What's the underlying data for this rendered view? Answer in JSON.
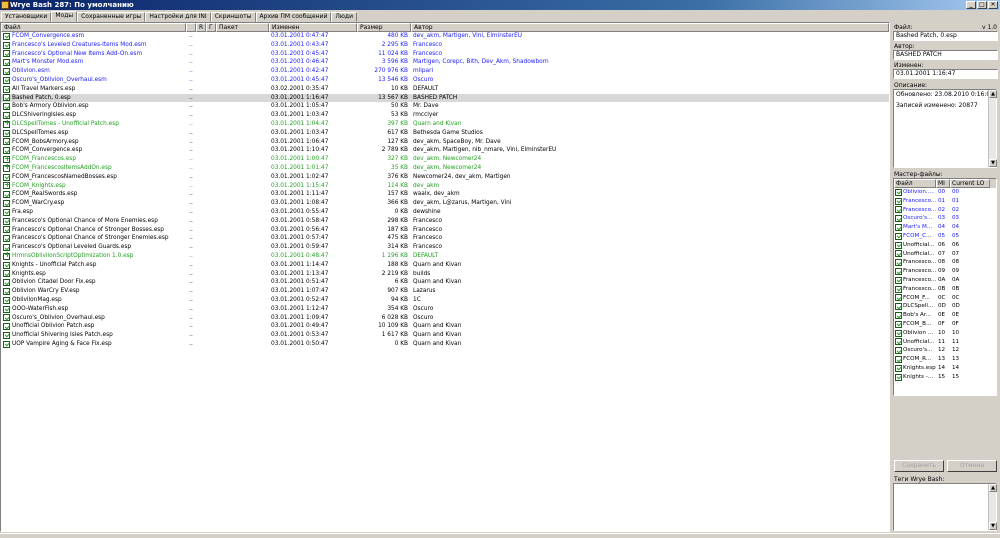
{
  "window": {
    "title": "Wrye Bash 287: По умолчанию",
    "minimize": "_",
    "maximize": "□",
    "close": "✕"
  },
  "tabs": [
    "Установщики",
    "Моды",
    "Сохраненные игры",
    "Настройки для INI",
    "Скриншоты",
    "Архив ПМ сообщений",
    "Люди"
  ],
  "active_tab": 1,
  "columns": {
    "file": "Файл",
    "flag1": "",
    "rating": "R",
    "group": "Г",
    "package": "Пакет",
    "modified": "Изменен",
    "size": "Размер",
    "author": "Автор"
  },
  "mods": [
    {
      "check": "on",
      "color": "blue",
      "file": "FCOM_Convergence.esm",
      "flag": "..",
      "modified": "03.01.2001 0:47:47",
      "size": "480 KB",
      "author": "dev_akm, Martigen, Vini, ElminsterEU"
    },
    {
      "check": "on",
      "color": "blue",
      "file": "Francesco's Leveled Creatures-Items Mod.esm",
      "flag": "..",
      "modified": "03.01.2001 0:43:47",
      "size": "2 295 KB",
      "author": "Francesco"
    },
    {
      "check": "on",
      "color": "blue",
      "file": "Francesco's Optional New Items Add-On.esm",
      "flag": "..",
      "modified": "03.01.2001 0:45:47",
      "size": "11 024 KB",
      "author": "Francesco"
    },
    {
      "check": "on",
      "color": "blue",
      "file": "Mart's Monster Mod.esm",
      "flag": "..",
      "modified": "03.01.2001 0:46:47",
      "size": "3 596 KB",
      "author": "Martigen, Corepc, Bith, Dev_Akm, Shadowborn"
    },
    {
      "check": "on",
      "color": "blue",
      "file": "Oblivion.esm",
      "flag": "..",
      "modified": "03.01.2001 0:42:47",
      "size": "270 976 KB",
      "author": "mlipari"
    },
    {
      "check": "on",
      "color": "blue",
      "file": "Oscuro's_Oblivion_Overhaul.esm",
      "flag": "..",
      "modified": "03.01.2001 0:45:47",
      "size": "13 546 KB",
      "author": "Oscuro"
    },
    {
      "check": "on",
      "color": "black",
      "file": "All Travel Markers.esp",
      "flag": "..",
      "modified": "03.02.2001 0:35:47",
      "size": "10 KB",
      "author": "DEFAULT"
    },
    {
      "check": "on",
      "color": "black",
      "file": "Bashed Patch, 0.esp",
      "flag": "..",
      "modified": "03.01.2001 1:16:47",
      "size": "13 567 KB",
      "author": "BASHED PATCH",
      "selected": true
    },
    {
      "check": "on",
      "color": "black",
      "file": "Bob's Armory Oblivion.esp",
      "flag": "..",
      "modified": "03.01.2001 1:05:47",
      "size": "50 KB",
      "author": "Mr. Dave"
    },
    {
      "check": "on",
      "color": "black",
      "file": "DLCShiveringIsles.esp",
      "flag": "..",
      "modified": "03.01.2001 1:03:47",
      "size": "53 KB",
      "author": "rmcclyer"
    },
    {
      "check": "plus",
      "color": "green",
      "file": "DLCSpellTomes - Unofficial Patch.esp",
      "flag": "..",
      "modified": "03.01.2001 1:04:47",
      "size": "397 KB",
      "author": "Quarn and Kivan"
    },
    {
      "check": "on",
      "color": "black",
      "file": "DLCSpellTomes.esp",
      "flag": "..",
      "modified": "03.01.2001 1:03:47",
      "size": "617 KB",
      "author": "Bethesda Game Studios"
    },
    {
      "check": "on",
      "color": "black",
      "file": "FCOM_BobsArmory.esp",
      "flag": "..",
      "modified": "03.01.2001 1:06:47",
      "size": "127 KB",
      "author": "dev_akm, SpaceBoy, Mr. Dave"
    },
    {
      "check": "on",
      "color": "black",
      "file": "FCOM_Convergence.esp",
      "flag": "..",
      "modified": "03.01.2001 1:10:47",
      "size": "2 789 KB",
      "author": "dev_akm, Martigen, nib_nmare, Vini, ElminsterEU"
    },
    {
      "check": "plus",
      "color": "green",
      "file": "FCOM_Francescos.esp",
      "flag": "..",
      "modified": "03.01.2001 1:00:47",
      "size": "327 KB",
      "author": "dev_akm, Newcomer24"
    },
    {
      "check": "plus",
      "color": "green",
      "file": "FCOM_FrancescosItemsAddOn.esp",
      "flag": "..",
      "modified": "03.01.2001 1:01:47",
      "size": "35 KB",
      "author": "dev_akm, Newcomer24"
    },
    {
      "check": "on",
      "color": "black",
      "file": "FCOM_FrancescosNamedBosses.esp",
      "flag": "..",
      "modified": "03.01.2001 1:02:47",
      "size": "376 KB",
      "author": "Newcomer24, dev_akm, Martigen"
    },
    {
      "check": "plus",
      "color": "green",
      "file": "FCOM_Knights.esp",
      "flag": "..",
      "modified": "03.01.2001 1:15:47",
      "size": "114 KB",
      "author": "dev_akm"
    },
    {
      "check": "on",
      "color": "black",
      "file": "FCOM_RealSwords.esp",
      "flag": "..",
      "modified": "03.01.2001 1:11:47",
      "size": "157 KB",
      "author": "waalx, dev_akm"
    },
    {
      "check": "on",
      "color": "black",
      "file": "FCOM_WarCry.esp",
      "flag": "..",
      "modified": "03.01.2001 1:08:47",
      "size": "366 KB",
      "author": "dev_akm, L@zarus, Martigen, Vini"
    },
    {
      "check": "on",
      "color": "black",
      "file": "Fra.esp",
      "flag": "..",
      "modified": "03.01.2001 0:55:47",
      "size": "0 KB",
      "author": "dewshine"
    },
    {
      "check": "on",
      "color": "black",
      "file": "Francesco's Optional Chance of More Enemies.esp",
      "flag": "..",
      "modified": "03.01.2001 0:58:47",
      "size": "298 KB",
      "author": "Francesco"
    },
    {
      "check": "on",
      "color": "black",
      "file": "Francesco's Optional Chance of Stronger Bosses.esp",
      "flag": "..",
      "modified": "03.01.2001 0:56:47",
      "size": "187 KB",
      "author": "Francesco"
    },
    {
      "check": "on",
      "color": "black",
      "file": "Francesco's Optional Chance of Stronger Enemies.esp",
      "flag": "..",
      "modified": "03.01.2001 0:57:47",
      "size": "475 KB",
      "author": "Francesco"
    },
    {
      "check": "on",
      "color": "black",
      "file": "Francesco's Optional Leveled Guards.esp",
      "flag": "..",
      "modified": "03.01.2001 0:59:47",
      "size": "314 KB",
      "author": "Francesco"
    },
    {
      "check": "plus",
      "color": "green",
      "file": "HrmnsObliviionScriptOptimization 1.0.esp",
      "flag": "..",
      "modified": "03.01.2001 0:48:47",
      "size": "1 196 KB",
      "author": "DEFAULT"
    },
    {
      "check": "on",
      "color": "black",
      "file": "Knights - Unofficial Patch.esp",
      "flag": "..",
      "modified": "03.01.2001 1:14:47",
      "size": "188 KB",
      "author": "Quarn and Kivan"
    },
    {
      "check": "on",
      "color": "black",
      "file": "Knights.esp",
      "flag": "..",
      "modified": "03.01.2001 1:13:47",
      "size": "2 219 KB",
      "author": "builds"
    },
    {
      "check": "on",
      "color": "black",
      "file": "Oblivion Citadel Door Fix.esp",
      "flag": "..",
      "modified": "03.01.2001 0:51:47",
      "size": "6 KB",
      "author": "Quarn and Kivan"
    },
    {
      "check": "on",
      "color": "black",
      "file": "Oblivion WarCry EV.esp",
      "flag": "..",
      "modified": "03.01.2001 1:07:47",
      "size": "907 KB",
      "author": "Lazarus"
    },
    {
      "check": "on",
      "color": "black",
      "file": "ObliviionMag.esp",
      "flag": "..",
      "modified": "03.01.2001 0:52:47",
      "size": "94 KB",
      "author": "1C"
    },
    {
      "check": "on",
      "color": "black",
      "file": "OOO-WaterFish.esp",
      "flag": "..",
      "modified": "03.01.2001 1:12:47",
      "size": "354 KB",
      "author": "Oscuro"
    },
    {
      "check": "on",
      "color": "black",
      "file": "Oscuro's_Oblivion_Overhaul.esp",
      "flag": "..",
      "modified": "03.01.2001 1:09:47",
      "size": "6 028 KB",
      "author": "Oscuro"
    },
    {
      "check": "on",
      "color": "black",
      "file": "Unofficial Oblivion Patch.esp",
      "flag": "..",
      "modified": "03.01.2001 0:49:47",
      "size": "10 109 KB",
      "author": "Quarn and Kivan"
    },
    {
      "check": "on",
      "color": "black",
      "file": "Unofficial Shivering Isles Patch.esp",
      "flag": "..",
      "modified": "03.01.2001 0:53:47",
      "size": "1 617 KB",
      "author": "Quarn and Kivan"
    },
    {
      "check": "on",
      "color": "black",
      "file": "UOP Vampire Aging & Face Fix.esp",
      "flag": "..",
      "modified": "03.01.2001 0:50:47",
      "size": "0 KB",
      "author": "Quarn and Kivan"
    }
  ],
  "side": {
    "file_label": "Файл:",
    "version": "v 1.0",
    "file_value": "Bashed Patch, 0.esp",
    "author_label": "Автор:",
    "author_value": "BASHED PATCH",
    "modified_label": "Изменен:",
    "modified_value": "03.01.2001 1:16:47",
    "desc_label": "Описание:",
    "desc_line1": "Обновлено: 23.08.2010 0:16:00",
    "desc_line2": "Записей изменено: 20877",
    "masters_label": "Мастер-файлы:",
    "masters_cols": {
      "file": "Файл",
      "mi": "MI",
      "cur": "Current LO"
    },
    "masters": [
      {
        "file": "Oblivion.....",
        "mi": "00",
        "cur": "00",
        "color": "blue"
      },
      {
        "file": "Francesco...",
        "mi": "01",
        "cur": "01",
        "color": "blue"
      },
      {
        "file": "Francesco...",
        "mi": "02",
        "cur": "02",
        "color": "blue"
      },
      {
        "file": "Oscuro's...",
        "mi": "03",
        "cur": "03",
        "color": "blue"
      },
      {
        "file": "Mart's M...",
        "mi": "04",
        "cur": "04",
        "color": "blue"
      },
      {
        "file": "FCOM_C...",
        "mi": "05",
        "cur": "05",
        "color": "blue"
      },
      {
        "file": "Unofficial...",
        "mi": "06",
        "cur": "06",
        "color": "black"
      },
      {
        "file": "Unofficial...",
        "mi": "07",
        "cur": "07",
        "color": "black"
      },
      {
        "file": "Francesco...",
        "mi": "08",
        "cur": "08",
        "color": "black"
      },
      {
        "file": "Francesco...",
        "mi": "09",
        "cur": "09",
        "color": "black"
      },
      {
        "file": "Francesco...",
        "mi": "0A",
        "cur": "0A",
        "color": "black"
      },
      {
        "file": "Francesco...",
        "mi": "0B",
        "cur": "0B",
        "color": "black"
      },
      {
        "file": "FCOM_F...",
        "mi": "0C",
        "cur": "0C",
        "color": "black"
      },
      {
        "file": "DLCSpell...",
        "mi": "0D",
        "cur": "0D",
        "color": "black"
      },
      {
        "file": "Bob's Ar...",
        "mi": "0E",
        "cur": "0E",
        "color": "black"
      },
      {
        "file": "FCOM_B...",
        "mi": "0F",
        "cur": "0F",
        "color": "black"
      },
      {
        "file": "Oblivion ...",
        "mi": "10",
        "cur": "10",
        "color": "black"
      },
      {
        "file": "Unofficial...",
        "mi": "11",
        "cur": "11",
        "color": "black"
      },
      {
        "file": "Oscuro's...",
        "mi": "12",
        "cur": "12",
        "color": "black"
      },
      {
        "file": "FCOM_R...",
        "mi": "13",
        "cur": "13",
        "color": "black"
      },
      {
        "file": "Knights.esp",
        "mi": "14",
        "cur": "14",
        "color": "black"
      },
      {
        "file": "Knights -...",
        "mi": "15",
        "cur": "15",
        "color": "black"
      }
    ],
    "save_btn": "Сохранить",
    "cancel_btn": "Отмена",
    "tags_label": "Теги Wrye Bash:"
  },
  "colors": {
    "blue": "#1a1aff",
    "green": "#22a022",
    "titlebar": "#0a246a"
  }
}
